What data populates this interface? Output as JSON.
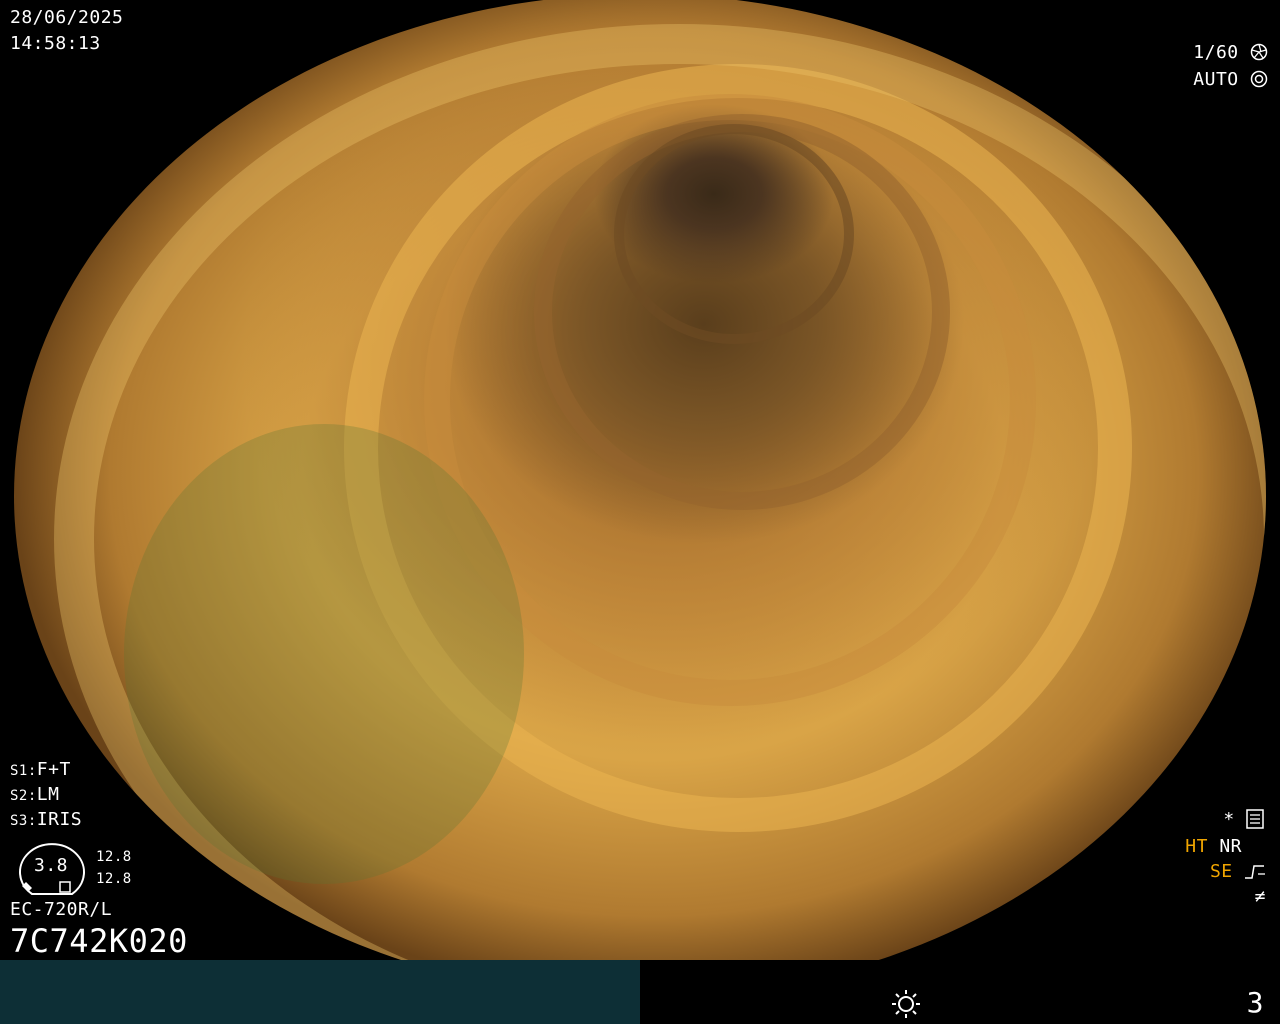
{
  "overlay": {
    "date": "28/06/2025",
    "time": "14:58:13",
    "shutter": "1/60",
    "exposure_mode": "AUTO",
    "settings": [
      {
        "slot": "S1:",
        "value": "F+T"
      },
      {
        "slot": "S2:",
        "value": "LM"
      },
      {
        "slot": "S3:",
        "value": "IRIS"
      }
    ],
    "gauge_value": "3.8",
    "gauge_side_top": "12.8",
    "gauge_side_bottom": "12.8",
    "scope_model": "EC-720R/L",
    "scope_serial": "7C742K020",
    "right_indicators": {
      "asterisk": "*",
      "ht": "HT",
      "nr": "NR",
      "se": "SE",
      "f_symbol": "≠"
    },
    "icons": {
      "shutter": "aperture-icon",
      "auto": "camera-icon",
      "settings": "menu-list-icon",
      "se": "enhance-curve-icon",
      "brightness": "sun-icon"
    },
    "colors": {
      "status_teal": "#0d2f36",
      "indicator_orange": "#f0a500"
    }
  },
  "statusbar": {
    "page_number": "3"
  }
}
